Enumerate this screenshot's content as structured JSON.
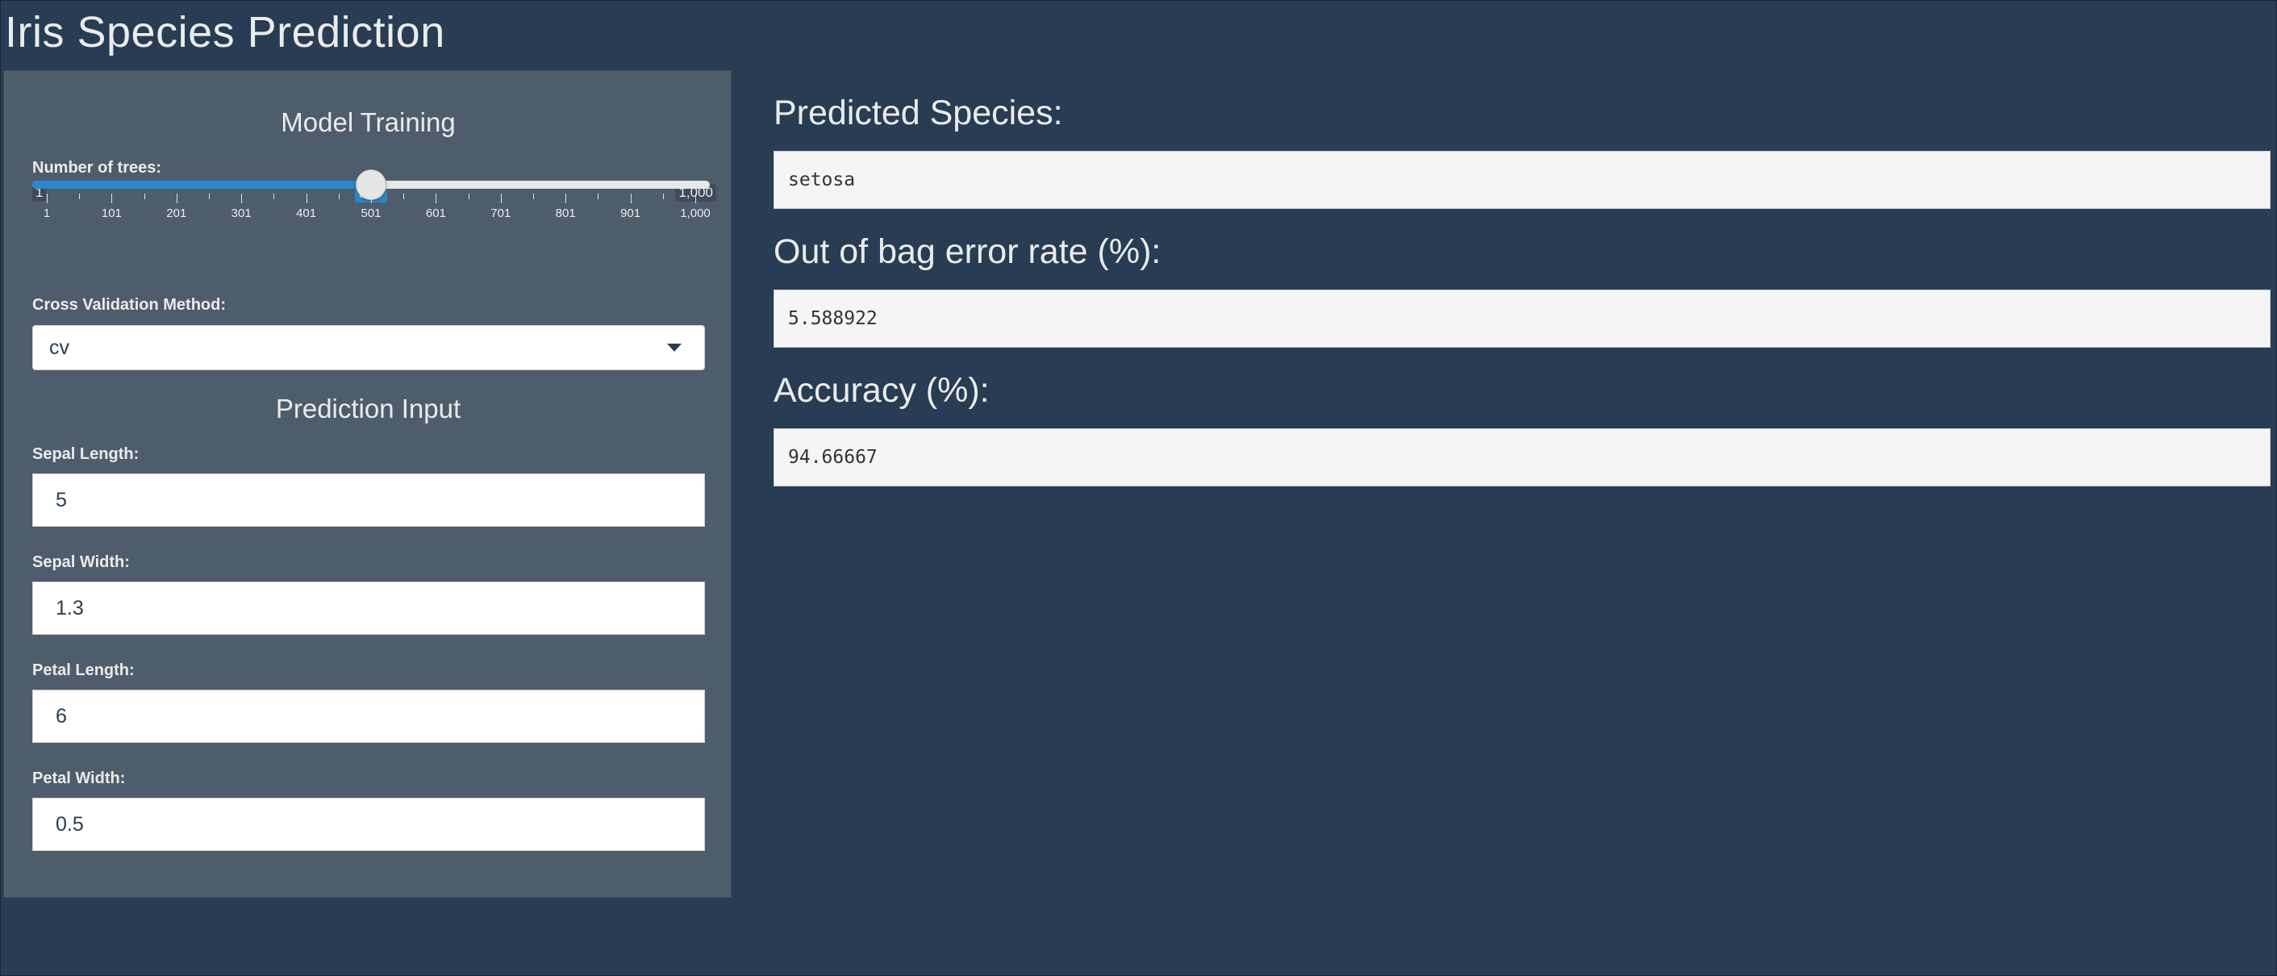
{
  "app": {
    "title": "Iris Species Prediction"
  },
  "sidebar": {
    "training": {
      "title": "Model Training",
      "trees": {
        "label": "Number of trees:",
        "min_label": "1",
        "max_label": "1,000",
        "value_label": "500",
        "min": 1,
        "max": 1000,
        "value": 500,
        "ticks": [
          "1",
          "101",
          "201",
          "301",
          "401",
          "501",
          "601",
          "701",
          "801",
          "901",
          "1,000"
        ]
      },
      "cv": {
        "label": "Cross Validation Method:",
        "selected": "cv"
      }
    },
    "prediction": {
      "title": "Prediction Input",
      "sepal_length": {
        "label": "Sepal Length:",
        "value": "5"
      },
      "sepal_width": {
        "label": "Sepal Width:",
        "value": "1.3"
      },
      "petal_length": {
        "label": "Petal Length:",
        "value": "6"
      },
      "petal_width": {
        "label": "Petal Width:",
        "value": "0.5"
      }
    }
  },
  "main": {
    "species": {
      "heading": "Predicted Species:",
      "value": "setosa"
    },
    "oob": {
      "heading": "Out of bag error rate (%):",
      "value": "5.588922"
    },
    "accuracy": {
      "heading": "Accuracy (%):",
      "value": "94.66667"
    }
  },
  "colors": {
    "background": "#2b3e50",
    "sidebar": "#4e5d6c",
    "accent": "#2a87c9"
  }
}
